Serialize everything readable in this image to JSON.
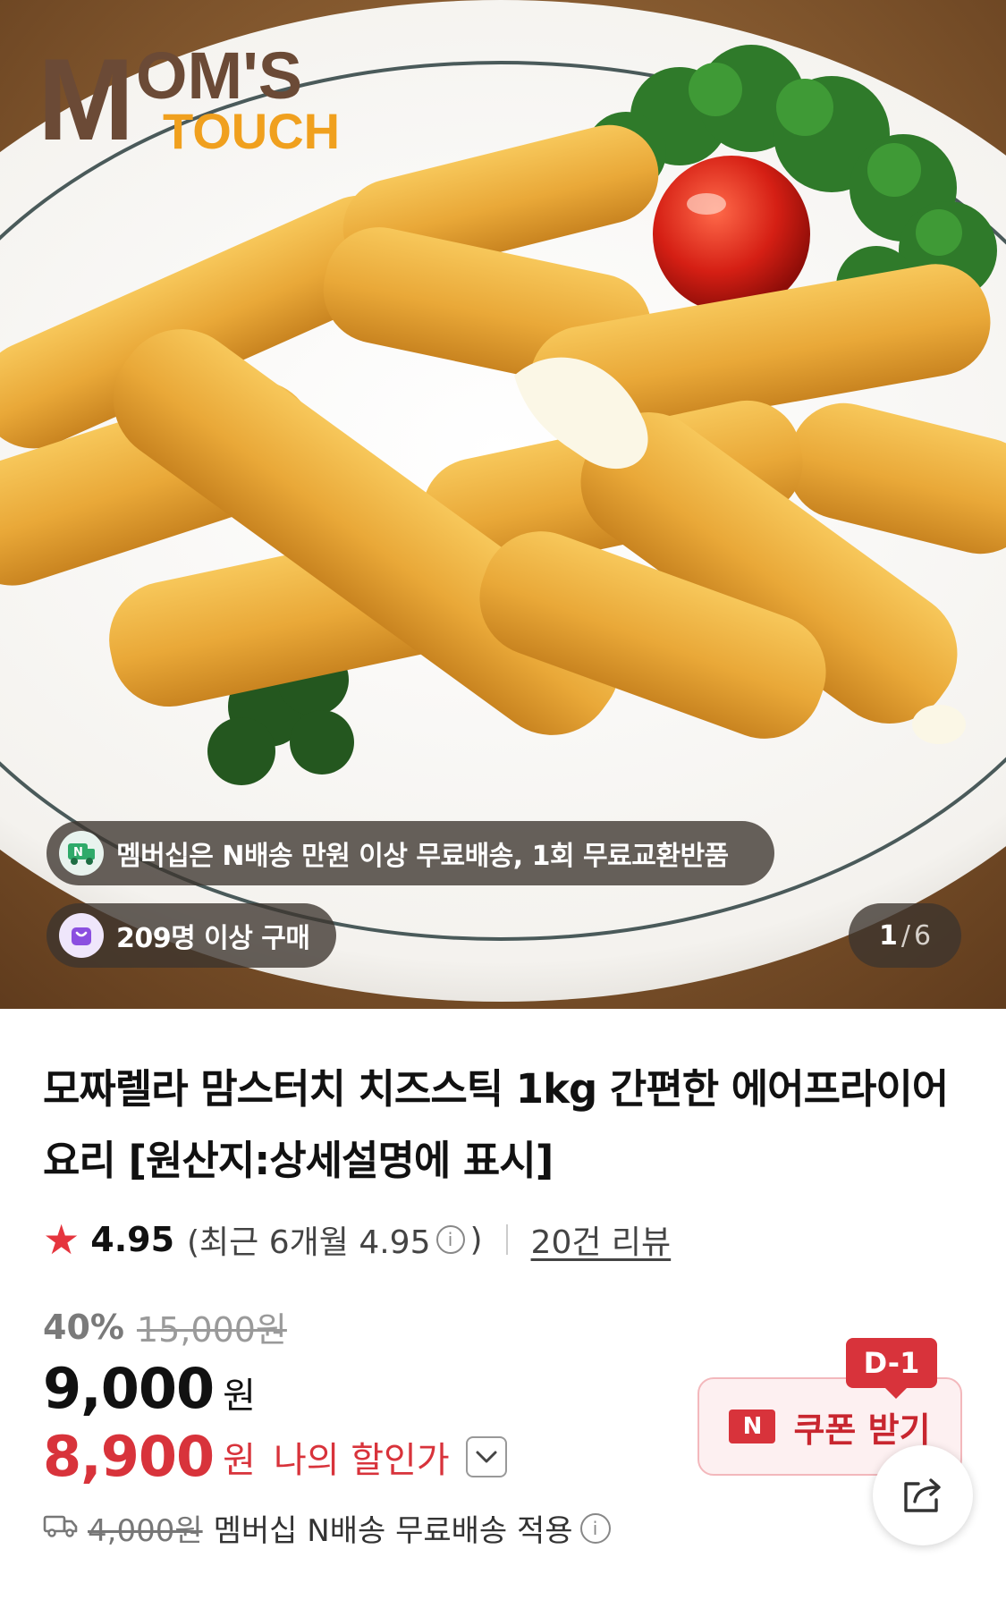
{
  "hero": {
    "brand_logo_text": "MOM'S TOUCH",
    "membership_notice": "멤버십은 N배송 만원 이상 무료배송, 1회 무료교환반품",
    "purchase_count": "209명 이상 구매",
    "page_current": "1",
    "page_separator": "/",
    "page_total": "6"
  },
  "product": {
    "title": "모짜렐라 맘스터치 치즈스틱 1kg 간편한 에어프라이어 요리 [원산지:상세설명에 표시]",
    "rating": "4.95",
    "recent_rating_prefix": "(최근 6개월 4.95",
    "recent_rating_suffix": ")",
    "review_count": "20건 리뷰",
    "discount_rate": "40%",
    "original_price": "15,000원",
    "price": "9,000",
    "price_unit": "원",
    "my_price": "8,900",
    "my_price_unit": "원",
    "my_price_label": "나의 할인가",
    "shipping_fee": "4,000원",
    "shipping_note": "멤버십 N배송 무료배송 적용"
  },
  "coupon": {
    "badge": "D-1",
    "logo": "N",
    "label": "쿠폰 받기"
  },
  "icons": {
    "rating": "star-icon",
    "info": "info-icon",
    "shipping": "truck-icon",
    "share": "share-icon",
    "dropdown": "chevron-down-icon"
  },
  "colors": {
    "accent_red": "#d8333b",
    "star": "#e5353e",
    "logo_brown": "#6b4a36",
    "logo_orange": "#f0a01e"
  }
}
